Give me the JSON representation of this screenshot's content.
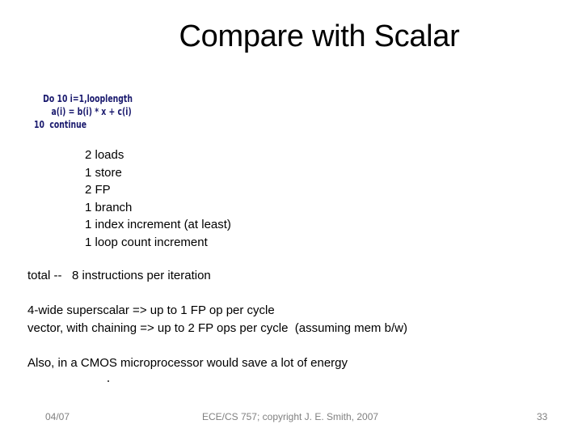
{
  "slide": {
    "title": "Compare with Scalar",
    "code": {
      "lines": [
        "Do 10 i=1,looplength",
        "a(i) = b(i) * x + c(i)",
        "10  continue"
      ],
      "text_color": "#1a1a6e"
    },
    "instruction_counts": [
      "2 loads",
      "1 store",
      "2 FP",
      "1 branch",
      "1 index increment (at least)",
      "1 loop count increment"
    ],
    "total": "total --   8 instructions per iteration",
    "comparisons": [
      "4-wide superscalar => up to 1 FP op per cycle",
      "vector, with chaining => up to 2 FP ops per cycle  (assuming mem b/w)"
    ],
    "energy_note": "Also, in a CMOS microprocessor would save a lot of energy"
  },
  "footer": {
    "date": "04/07",
    "copyright": "ECE/CS 757; copyright J. E. Smith, 2007",
    "page_number": "33"
  }
}
